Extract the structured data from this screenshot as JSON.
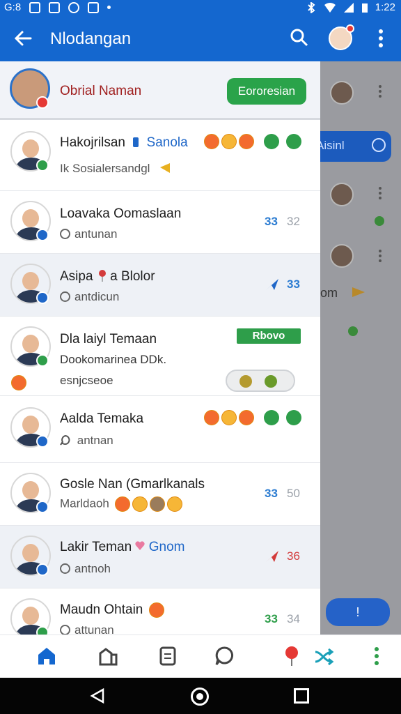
{
  "status_bar": {
    "left_text": "G:8",
    "time": "1:22"
  },
  "app_bar": {
    "title": "Nlodangan"
  },
  "profile": {
    "name": "Obrial Naman",
    "action_label": "Eororesian"
  },
  "background_panel": {
    "search_pill_text": "Aisinl",
    "partial_text": "om",
    "fab_text": "!"
  },
  "chats": [
    {
      "name": "Hakojrilsan",
      "name_highlight": "Sanola",
      "preview": "Ik Sosialersandgl",
      "time_a": "",
      "time_b": ""
    },
    {
      "name": "Loavaka Oomaslaan",
      "preview": "antunan",
      "time_a": "33",
      "time_b": "32"
    },
    {
      "name": "Asipa",
      "name_suffix": "a Blolor",
      "preview": "antdicun",
      "time_a": "33",
      "time_b": ""
    },
    {
      "name": "Dla laiyl Temaan",
      "preview": "Dookomarinea DDk.",
      "sub_preview": "esnjcseoe",
      "tag": "Rbovo"
    },
    {
      "name": "Aalda Temaka",
      "preview": "antnan",
      "time_a": "",
      "time_b": ""
    },
    {
      "name": "Gosle Nan (Gmarlkanals",
      "preview": "Marldaoh",
      "time_a": "33",
      "time_b": "50"
    },
    {
      "name": "Lakir Teman",
      "name_highlight": "Gnom",
      "preview": "antnoh",
      "time_a": "36",
      "time_b": ""
    },
    {
      "name": "Maudn Ohtain",
      "preview": "attunan",
      "time_a": "33",
      "time_b": "34"
    }
  ],
  "icons": {
    "back": "arrow-left-icon",
    "search": "search-icon",
    "menu": "more-vert-icon",
    "nav": [
      "home-icon",
      "store-icon",
      "document-icon",
      "chat-icon",
      "pin-icon",
      "shuffle-icon",
      "more-vert-icon"
    ]
  },
  "colors": {
    "primary": "#1467cf",
    "accent_green": "#2aa34a",
    "alert_red": "#e53935"
  }
}
